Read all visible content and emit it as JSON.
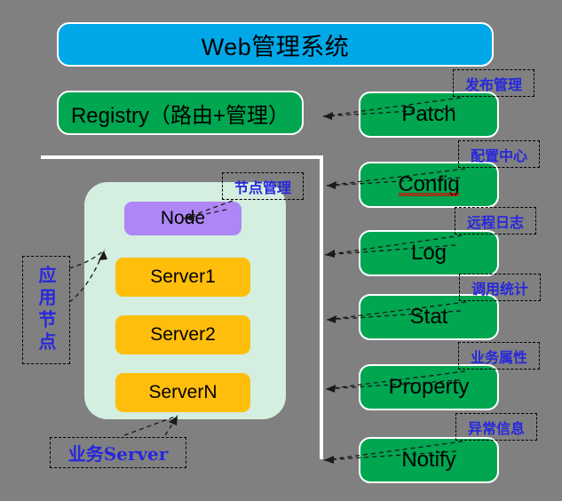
{
  "diagram": {
    "background_color": "#808080",
    "title": {
      "label": "Web管理系统",
      "color": "#00A8E8"
    },
    "registry": {
      "label": "Registry（路由+管理）",
      "color": "#00A650"
    },
    "application_node_group": {
      "container_color": "#D4EEDF",
      "node": {
        "label": "Node",
        "color": "#AE86F5"
      },
      "servers": [
        {
          "label": "Server1",
          "color": "#FFBE0B"
        },
        {
          "label": "Server2",
          "color": "#FFBE0B"
        },
        {
          "label": "ServerN",
          "color": "#FFBE0B"
        }
      ]
    },
    "services": [
      {
        "label": "Patch",
        "annotation": "发布管理",
        "color": "#00A650",
        "misspelled": false
      },
      {
        "label": "Config",
        "annotation": "配置中心",
        "color": "#00A650",
        "misspelled": true
      },
      {
        "label": "Log",
        "annotation": "远程日志",
        "color": "#00A650",
        "misspelled": false
      },
      {
        "label": "Stat",
        "annotation": "调用统计",
        "color": "#00A650",
        "misspelled": false
      },
      {
        "label": "Property",
        "annotation": "业务属性",
        "color": "#00A650",
        "misspelled": false
      },
      {
        "label": "Notify",
        "annotation": "异常信息",
        "color": "#00A650",
        "misspelled": false
      }
    ],
    "annotations": {
      "node_management": "节点管理",
      "application_node": "应用节点",
      "business_server": "业务Server",
      "annotation_color": "#2727DD"
    }
  }
}
